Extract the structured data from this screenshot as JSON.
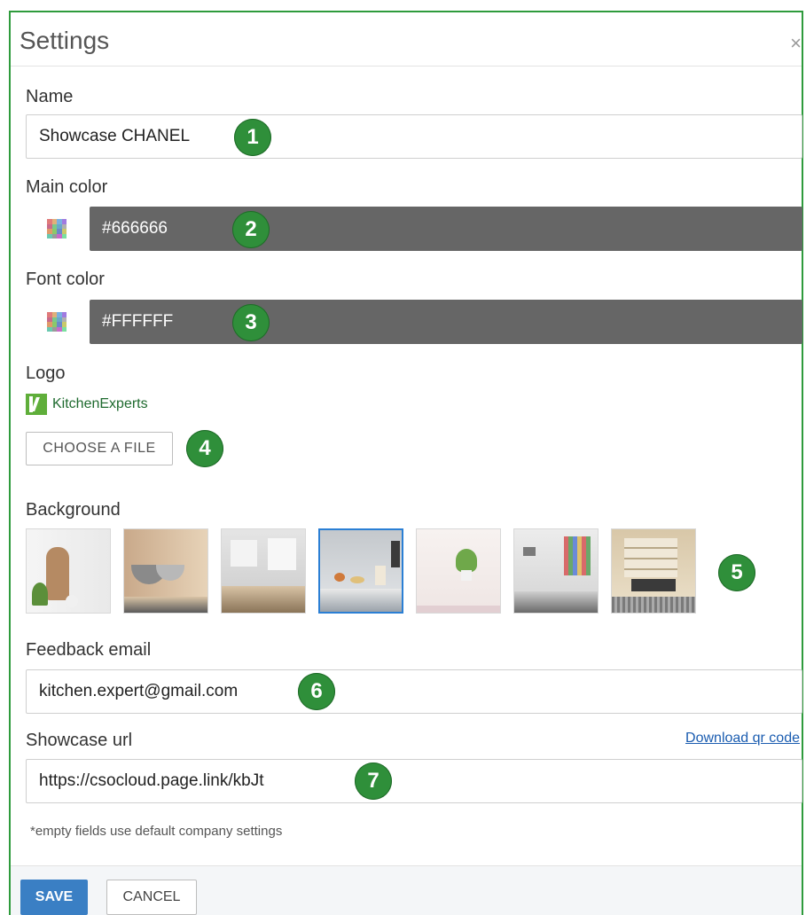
{
  "dialog": {
    "title": "Settings",
    "close_icon": "×"
  },
  "name": {
    "label": "Name",
    "value": "Showcase CHANEL"
  },
  "main_color": {
    "label": "Main color",
    "value": "#666666",
    "swatch": "#666666"
  },
  "font_color": {
    "label": "Font color",
    "value": "#FFFFFF",
    "swatch": "#666666"
  },
  "logo": {
    "label": "Logo",
    "text": "KitchenExperts",
    "choose_button": "CHOOSE A FILE"
  },
  "background": {
    "label": "Background",
    "thumbnails": [
      {
        "name": "bg-1",
        "selected": false
      },
      {
        "name": "bg-2",
        "selected": false
      },
      {
        "name": "bg-3",
        "selected": false
      },
      {
        "name": "bg-4",
        "selected": true
      },
      {
        "name": "bg-5",
        "selected": false
      },
      {
        "name": "bg-6",
        "selected": false
      },
      {
        "name": "bg-7",
        "selected": false
      }
    ]
  },
  "feedback": {
    "label": "Feedback email",
    "value": "kitchen.expert@gmail.com"
  },
  "showcase_url": {
    "label": "Showcase url",
    "value": "https://csocloud.page.link/kbJt",
    "download_link": "Download qr code"
  },
  "note": "*empty fields use default company settings",
  "footer": {
    "save": "SAVE",
    "cancel": "CANCEL"
  },
  "badges": [
    "1",
    "2",
    "3",
    "4",
    "5",
    "6",
    "7"
  ],
  "colors": {
    "accent": "#2e9b3c",
    "badge": "#2f8f3a",
    "primary_button": "#3a7fc4",
    "selected_border": "#2b7fd4"
  }
}
